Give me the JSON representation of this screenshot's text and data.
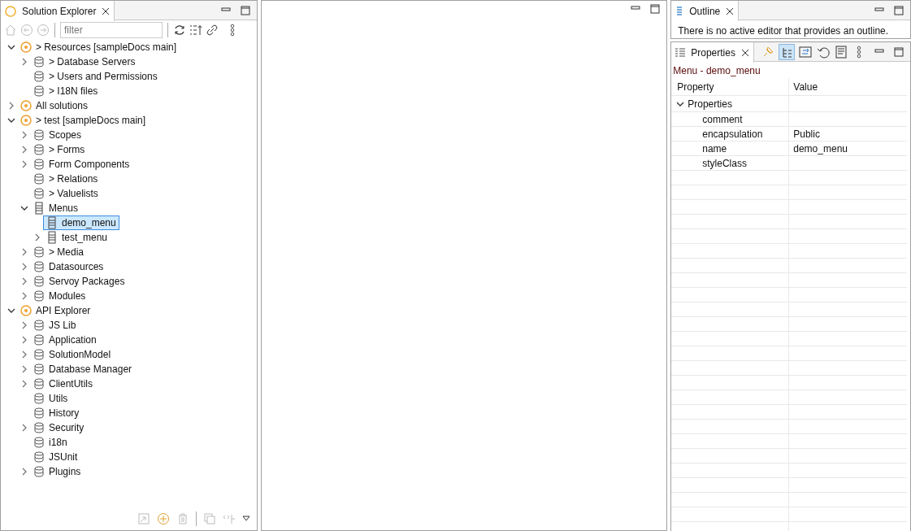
{
  "explorer": {
    "tab": {
      "title": "Solution Explorer"
    },
    "filter": {
      "placeholder": "filter"
    },
    "tree": [
      {
        "label": "> Resources [sampleDocs main]",
        "expanded": true,
        "selected": false,
        "children": [
          {
            "label": "> Database Servers",
            "expanded": false,
            "selected": false
          },
          {
            "label": "> Users and Permissions",
            "selected": false
          },
          {
            "label": "> I18N files",
            "selected": false
          }
        ]
      },
      {
        "label": "All solutions",
        "expanded": false,
        "selected": false
      },
      {
        "label": "> test [sampleDocs main]",
        "expanded": true,
        "selected": false,
        "children": [
          {
            "label": "Scopes",
            "expanded": false,
            "selected": false
          },
          {
            "label": "> Forms",
            "expanded": false,
            "selected": false
          },
          {
            "label": "Form Components",
            "expanded": false,
            "selected": false
          },
          {
            "label": "> Relations",
            "selected": false
          },
          {
            "label": "> Valuelists",
            "selected": false
          },
          {
            "label": "Menus",
            "expanded": true,
            "selected": false,
            "children": [
              {
                "label": "demo_menu",
                "selected": true
              },
              {
                "label": "test_menu",
                "expanded": false,
                "selected": false
              }
            ]
          },
          {
            "label": "> Media",
            "expanded": false,
            "selected": false
          },
          {
            "label": "Datasources",
            "expanded": false,
            "selected": false
          },
          {
            "label": "Servoy Packages",
            "expanded": false,
            "selected": false
          },
          {
            "label": "Modules",
            "expanded": false,
            "selected": false
          }
        ]
      },
      {
        "label": "API Explorer",
        "expanded": true,
        "selected": false,
        "children": [
          {
            "label": "JS Lib",
            "expanded": false,
            "selected": false
          },
          {
            "label": "Application",
            "expanded": false,
            "selected": false
          },
          {
            "label": "SolutionModel",
            "expanded": false,
            "selected": false
          },
          {
            "label": "Database Manager",
            "expanded": false,
            "selected": false
          },
          {
            "label": "ClientUtils",
            "expanded": false,
            "selected": false
          },
          {
            "label": "Utils",
            "selected": false
          },
          {
            "label": "History",
            "selected": false
          },
          {
            "label": "Security",
            "expanded": false,
            "selected": false
          },
          {
            "label": "i18n",
            "selected": false
          },
          {
            "label": "JSUnit",
            "selected": false
          },
          {
            "label": "Plugins",
            "expanded": false,
            "selected": false
          }
        ]
      }
    ]
  },
  "outline": {
    "tab": {
      "title": "Outline"
    },
    "message": "There is no active editor that provides an outline."
  },
  "properties": {
    "tab": {
      "title": "Properties"
    },
    "heading": "Menu - demo_menu",
    "columns": [
      "Property",
      "Value"
    ],
    "group": {
      "label": "Properties",
      "expanded": true
    },
    "rows": [
      {
        "property": "comment",
        "value": ""
      },
      {
        "property": "encapsulation",
        "value": "Public"
      },
      {
        "property": "name",
        "value": "demo_menu"
      },
      {
        "property": "styleClass",
        "value": ""
      }
    ]
  }
}
